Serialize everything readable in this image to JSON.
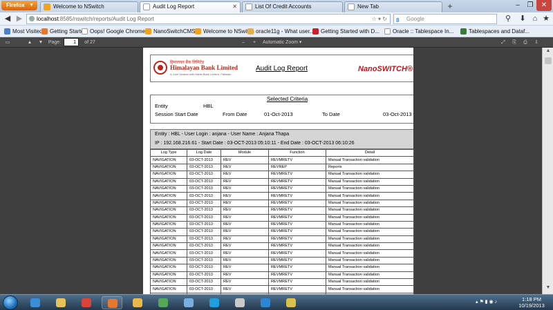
{
  "browser": {
    "firefox_label": "Firefox",
    "tabs": [
      {
        "label": "Welcome to NSwitch",
        "active": false
      },
      {
        "label": "Audit Log Report",
        "active": true
      },
      {
        "label": "List Of Credit Accounts",
        "active": false
      },
      {
        "label": "New Tab",
        "active": false
      }
    ],
    "new_tab_symbol": "+",
    "window_controls": {
      "minimize": "–",
      "maximize": "❐",
      "close": "✕"
    },
    "url_host": "localhost",
    "url_rest": ":8585/nswitch/reports/Audit Log Report",
    "search_engine": "Google",
    "search_placeholder": "Google"
  },
  "bookmarks": [
    {
      "label": "Most Visited",
      "color": "#4b7fc9"
    },
    {
      "label": "Getting Started",
      "color": "#e8772a"
    },
    {
      "label": "Oops! Google Chrome...",
      "color": "#ffffff"
    },
    {
      "label": "NanoSwitchCMS",
      "color": "#f0a31e"
    },
    {
      "label": "Welcome to NSwitch",
      "color": "#f0a31e"
    },
    {
      "label": "oracle11g - What user...",
      "color": "#e3b04b"
    },
    {
      "label": "Getting Started with D...",
      "color": "#c8202a"
    },
    {
      "label": "Oracle :: Tablespace In...",
      "color": "#ffffff"
    },
    {
      "label": "Tablespaces and Dataf...",
      "color": "#3a7a3a"
    }
  ],
  "pdf_toolbar": {
    "page_label": "Page:",
    "page_number": "1",
    "page_total": "of 27",
    "zoom": "Automatic Zoom",
    "zoom_out": "–",
    "zoom_in": "+"
  },
  "report": {
    "bank_name": "Himalayan Bank Limited",
    "bank_name_native": "हिमालयन बैंक लिमिटेड",
    "bank_tagline": "A Joint Venture with Habib Bank Limited, Pakistan",
    "title": "Audit Log Report",
    "product_logo": "NanoSWITCH®",
    "criteria_title": "Selected Criteria",
    "entity_label": "Entity",
    "entity_value": "HBL",
    "session_label": "Session Start Date",
    "from_label": "From Date",
    "from_value": "01-Oct-2013",
    "to_label": "To Date",
    "to_value": "03-Oct-2013",
    "info_line1": "Entity : HBL  -  User Login : anjana  -  User Name : Anjana Thapa",
    "info_line2": "IP : 192.168.216.61  -  Start Date : 03-OCT-2013 05:10:11  -  End Date : 03-OCT-2013 06:10:26",
    "columns": [
      "Log Type",
      "Log Date",
      "Module",
      "Function",
      "Detail"
    ],
    "rows": [
      [
        "NAVIGATION",
        "03-OCT-2013",
        "REV",
        "REVMRETV",
        "Manual Transaction validation"
      ],
      [
        "NAVIGATION",
        "03-OCT-2013",
        "REV",
        "REVREP",
        "Reports"
      ],
      [
        "NAVIGATION",
        "03-OCT-2013",
        "REV",
        "REVMRETV",
        "Manual Transaction validation"
      ],
      [
        "NAVIGATION",
        "03-OCT-2013",
        "REV",
        "REVMRETV",
        "Manual Transaction validation"
      ],
      [
        "NAVIGATION",
        "03-OCT-2013",
        "REV",
        "REVMRETV",
        "Manual Transaction validation"
      ],
      [
        "NAVIGATION",
        "03-OCT-2013",
        "REV",
        "REVMRETV",
        "Manual Transaction validation"
      ],
      [
        "NAVIGATION",
        "03-OCT-2013",
        "REV",
        "REVMRETV",
        "Manual Transaction validation"
      ],
      [
        "NAVIGATION",
        "03-OCT-2013",
        "REV",
        "REVMRETV",
        "Manual Transaction validation"
      ],
      [
        "NAVIGATION",
        "03-OCT-2013",
        "REV",
        "REVMRETV",
        "Manual Transaction validation"
      ],
      [
        "NAVIGATION",
        "03-OCT-2013",
        "REV",
        "REVMRETV",
        "Manual Transaction validation"
      ],
      [
        "NAVIGATION",
        "03-OCT-2013",
        "REV",
        "REVMRETV",
        "Manual Transaction validation"
      ],
      [
        "NAVIGATION",
        "03-OCT-2013",
        "REV",
        "REVMRETV",
        "Manual Transaction validation"
      ],
      [
        "NAVIGATION",
        "03-OCT-2013",
        "REV",
        "REVMRETV",
        "Manual Transaction validation"
      ],
      [
        "NAVIGATION",
        "03-OCT-2013",
        "REV",
        "REVMRETV",
        "Manual Transaction validation"
      ],
      [
        "NAVIGATION",
        "03-OCT-2013",
        "REV",
        "REVMRETV",
        "Manual Transaction validation"
      ],
      [
        "NAVIGATION",
        "03-OCT-2013",
        "REV",
        "REVMRETV",
        "Manual Transaction validation"
      ],
      [
        "NAVIGATION",
        "03-OCT-2013",
        "REV",
        "REVMRETV",
        "Manual Transaction validation"
      ],
      [
        "NAVIGATION",
        "03-OCT-2013",
        "REV",
        "REVMRETV",
        "Manual Transaction validation"
      ],
      [
        "NAVIGATION",
        "03-OCT-2013",
        "REV",
        "REVMRETV",
        "Manual Transaction validation"
      ],
      [
        "NAVIGATION",
        "03-OCT-2013",
        "REV",
        "REVMRETV",
        "Manual Transaction validation"
      ]
    ]
  },
  "taskbar": {
    "apps": [
      {
        "name": "internet-explorer-icon",
        "color": "#3b8fd9",
        "running": false
      },
      {
        "name": "file-explorer-icon",
        "color": "#e6c35a",
        "running": false
      },
      {
        "name": "chrome-icon",
        "color": "#d8433a",
        "running": false
      },
      {
        "name": "firefox-icon",
        "color": "#e8772a",
        "running": true
      },
      {
        "name": "folder-icon",
        "color": "#e8b84a",
        "running": false
      },
      {
        "name": "installer-icon",
        "color": "#55a85a",
        "running": false
      },
      {
        "name": "virtualbox-icon",
        "color": "#7aaee0",
        "running": false
      },
      {
        "name": "skype-icon",
        "color": "#1ea0e0",
        "running": false
      },
      {
        "name": "java-icon",
        "color": "#c9c9c9",
        "running": false
      },
      {
        "name": "remote-desktop-icon",
        "color": "#2c86d3",
        "running": false
      },
      {
        "name": "paint-icon",
        "color": "#d9c24a",
        "running": false
      }
    ],
    "time": "1:18 PM",
    "date": "10/19/2013"
  }
}
